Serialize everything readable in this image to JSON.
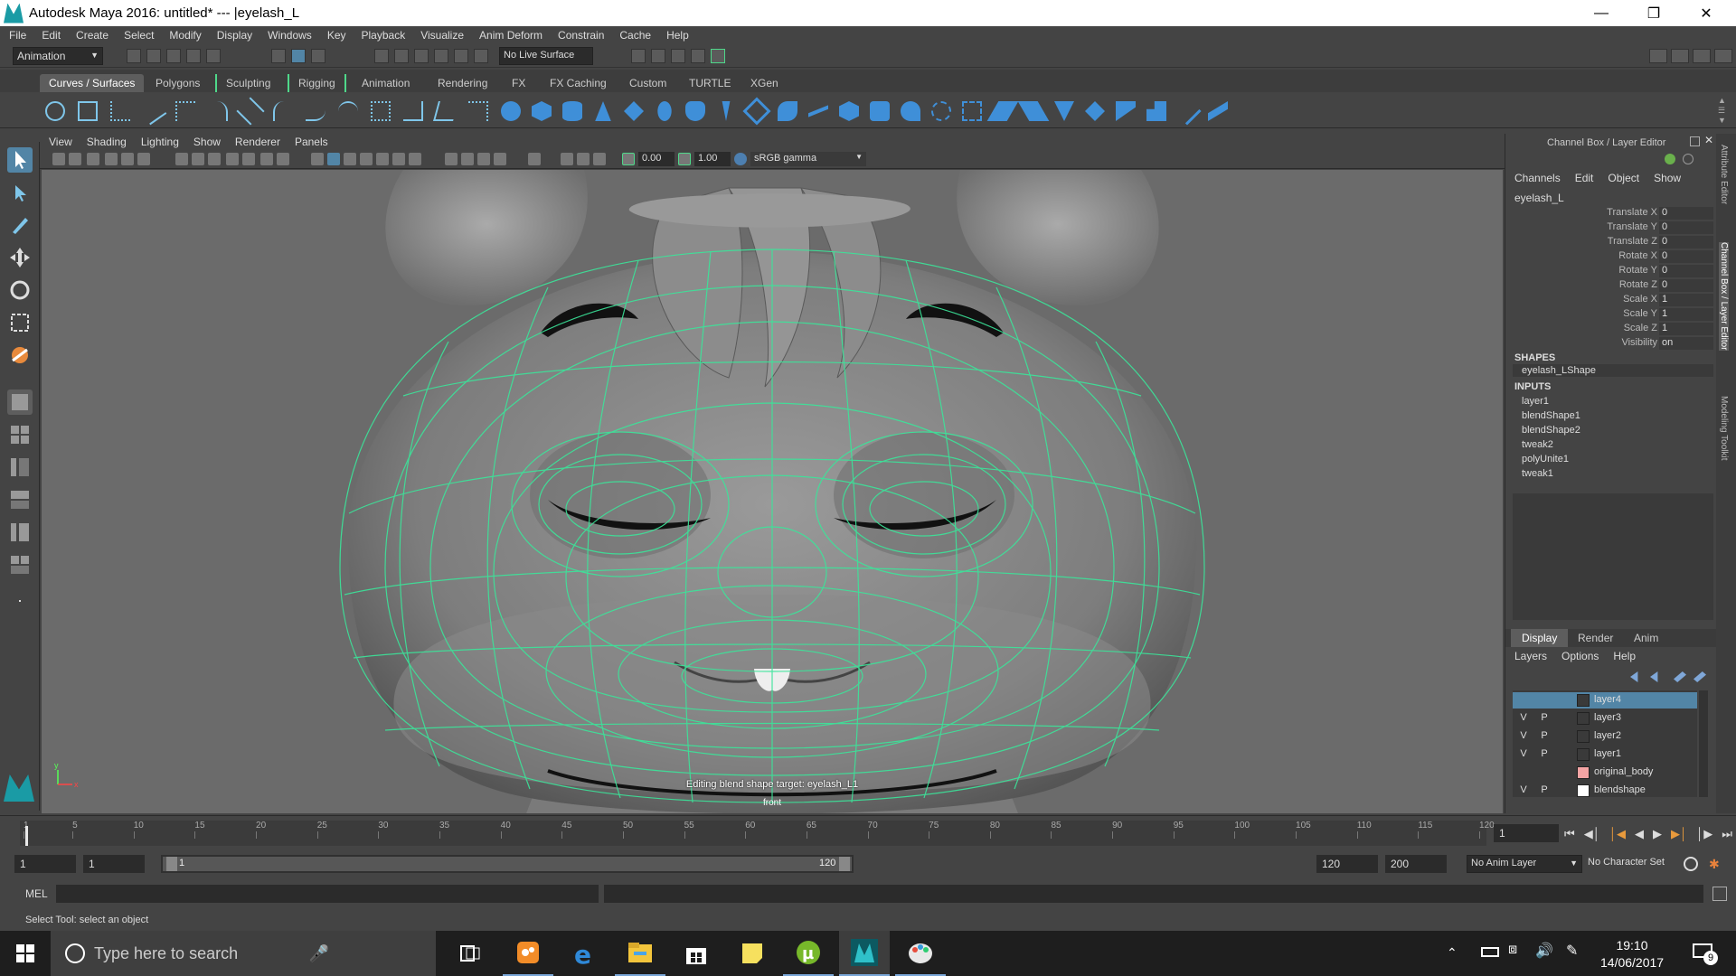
{
  "window": {
    "title": "Autodesk Maya 2016: untitled*   ---   |eyelash_L"
  },
  "menu": [
    "File",
    "Edit",
    "Create",
    "Select",
    "Modify",
    "Display",
    "Windows",
    "Key",
    "Playback",
    "Visualize",
    "Anim Deform",
    "Constrain",
    "Cache",
    "Help"
  ],
  "status": {
    "mode": "Animation",
    "live_surface": "No Live Surface"
  },
  "shelf_tabs": [
    "Curves / Surfaces",
    "Polygons",
    "Sculpting",
    "Rigging",
    "Animation",
    "Rendering",
    "FX",
    "FX Caching",
    "Custom",
    "TURTLE",
    "XGen"
  ],
  "viewport": {
    "menu": [
      "View",
      "Shading",
      "Lighting",
      "Show",
      "Renderer",
      "Panels"
    ],
    "exposure": "0.00",
    "gamma": "1.00",
    "color_space": "sRGB gamma",
    "hud_message": "Editing blend shape target: eyelash_L1",
    "camera_label": "front"
  },
  "channel_box": {
    "title": "Channel Box / Layer Editor",
    "menu": [
      "Channels",
      "Edit",
      "Object",
      "Show"
    ],
    "object": "eyelash_L",
    "attributes": [
      {
        "name": "Translate X",
        "value": "0"
      },
      {
        "name": "Translate Y",
        "value": "0"
      },
      {
        "name": "Translate Z",
        "value": "0"
      },
      {
        "name": "Rotate X",
        "value": "0"
      },
      {
        "name": "Rotate Y",
        "value": "0"
      },
      {
        "name": "Rotate Z",
        "value": "0"
      },
      {
        "name": "Scale X",
        "value": "1"
      },
      {
        "name": "Scale Y",
        "value": "1"
      },
      {
        "name": "Scale Z",
        "value": "1"
      },
      {
        "name": "Visibility",
        "value": "on"
      }
    ],
    "shapes_header": "SHAPES",
    "shape": "eyelash_LShape",
    "inputs_header": "INPUTS",
    "inputs": [
      "layer1",
      "blendShape1",
      "blendShape2",
      "tweak2",
      "polyUnite1",
      "tweak1"
    ]
  },
  "layer_editor": {
    "tabs": [
      "Display",
      "Render",
      "Anim"
    ],
    "menu": [
      "Layers",
      "Options",
      "Help"
    ],
    "layers": [
      {
        "v": "",
        "p": "",
        "name": "layer4",
        "color": "#3a3a3a",
        "selected": true
      },
      {
        "v": "V",
        "p": "P",
        "name": "layer3",
        "color": "#3a3a3a",
        "selected": false
      },
      {
        "v": "V",
        "p": "P",
        "name": "layer2",
        "color": "#3a3a3a",
        "selected": false
      },
      {
        "v": "V",
        "p": "P",
        "name": "layer1",
        "color": "#3a3a3a",
        "selected": false
      },
      {
        "v": "",
        "p": "",
        "name": "original_body",
        "color": "#f4a4a4",
        "selected": false
      },
      {
        "v": "V",
        "p": "P",
        "name": "blendshape",
        "color": "#ffffff",
        "selected": false
      }
    ]
  },
  "side_tabs": [
    "Attribute Editor",
    "Channel Box / Layer Editor",
    "Modeling Toolkit"
  ],
  "timeline": {
    "ticks": [
      "1",
      "5",
      "10",
      "15",
      "20",
      "25",
      "30",
      "35",
      "40",
      "45",
      "50",
      "55",
      "60",
      "65",
      "70",
      "75",
      "80",
      "85",
      "90",
      "95",
      "100",
      "105",
      "110",
      "115",
      "120"
    ],
    "current_frame": "1",
    "range_start": "1",
    "playback_start": "1",
    "slider_start": "1",
    "slider_end": "120",
    "playback_end": "120",
    "range_end": "200",
    "anim_layer": "No Anim Layer",
    "character_set": "No Character Set"
  },
  "command_line": {
    "label": "MEL"
  },
  "help_line": "Select Tool: select an object",
  "taskbar": {
    "search_placeholder": "Type here to search",
    "time": "19:10",
    "date": "14/06/2017",
    "notifications": "9"
  }
}
